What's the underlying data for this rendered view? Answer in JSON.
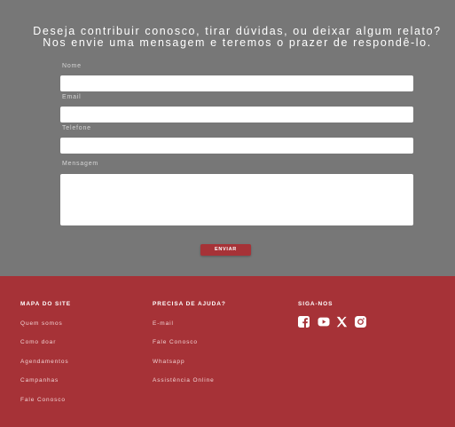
{
  "contact": {
    "headline_line1": "Deseja contribuir conosco, tirar dúvidas, ou deixar algum relato?",
    "headline_line2": "Nos envie uma mensagem e teremos o prazer de respondê-lo.",
    "fields": {
      "name_label": "Nome",
      "email_label": "Email",
      "phone_label": "Telefone",
      "message_label": "Mensagem"
    },
    "submit_label": "ENVIAR"
  },
  "footer": {
    "sitemap": {
      "title": "MAPA DO SITE",
      "links": [
        "Quem somos",
        "Como doar",
        "Agendamentos",
        "Campanhas",
        "Fale Conosco"
      ]
    },
    "help": {
      "title": "PRECISA DE AJUDA?",
      "links": [
        "E-mail",
        "Fale Conosco",
        "Whatsapp",
        "Assistência Online"
      ]
    },
    "social": {
      "title": "SIGA-NOS",
      "icons": [
        "facebook-icon",
        "youtube-icon",
        "x-twitter-icon",
        "instagram-icon"
      ]
    }
  },
  "colors": {
    "background": "#777777",
    "brand_red": "#a63237",
    "white": "#ffffff"
  }
}
